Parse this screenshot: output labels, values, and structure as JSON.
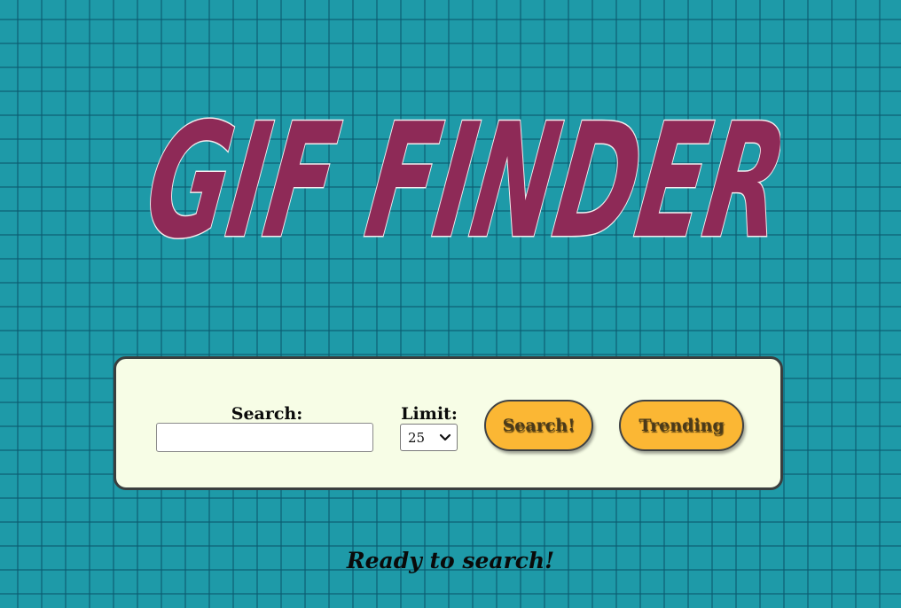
{
  "logo": {
    "text": "GIF FINDER",
    "fill_color": "#8e2a57",
    "outline_color": "#f4ecee"
  },
  "search": {
    "label": "Search:",
    "value": "",
    "placeholder": ""
  },
  "limit": {
    "label": "Limit:",
    "selected": "25",
    "icon": "chevron-down-icon"
  },
  "buttons": {
    "search_label": "Search!",
    "trending_label": "Trending"
  },
  "status": {
    "text": "Ready to search!"
  },
  "colors": {
    "background": "#1e9aa8",
    "grid_lines": "#0a5a6e",
    "panel": "#f7fde6",
    "button": "#fbb734"
  }
}
